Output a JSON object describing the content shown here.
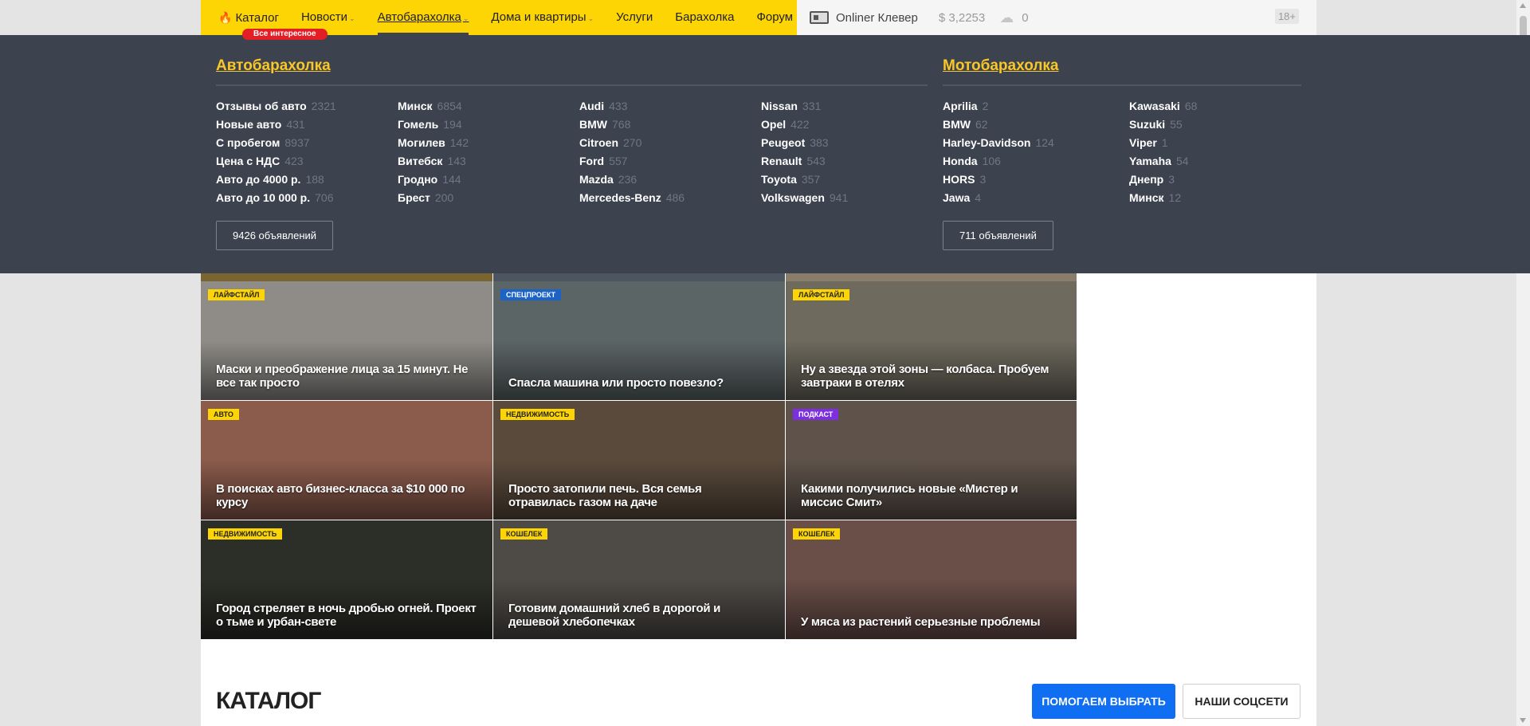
{
  "topbar": {
    "nav": [
      {
        "label": "Каталог",
        "icon": "flame-icon",
        "has_dropdown": false,
        "active": false
      },
      {
        "label": "Новости",
        "has_dropdown": true,
        "active": false
      },
      {
        "label": "Автобарахолка",
        "has_dropdown": true,
        "active": true
      },
      {
        "label": "Дома и квартиры",
        "has_dropdown": true,
        "active": false
      },
      {
        "label": "Услуги",
        "has_dropdown": false,
        "active": false
      },
      {
        "label": "Барахолка",
        "has_dropdown": false,
        "active": false
      },
      {
        "label": "Форум",
        "has_dropdown": false,
        "active": false
      }
    ],
    "promo_badge": "Все интересное",
    "clever": "Onliner Клевер",
    "currency_rate": "$ 3,2253",
    "weather_temp": "0",
    "age_badge": "18+"
  },
  "dropdown": {
    "auto": {
      "title": "Автобарахолка",
      "columns": [
        [
          {
            "name": "Отзывы об авто",
            "count": "2321"
          },
          {
            "name": "Новые авто",
            "count": "431"
          },
          {
            "name": "С пробегом",
            "count": "8937"
          },
          {
            "name": "Цена с НДС",
            "count": "423"
          },
          {
            "name": "Авто до 4000 р.",
            "count": "188"
          },
          {
            "name": "Авто до 10 000 р.",
            "count": "706"
          }
        ],
        [
          {
            "name": "Минск",
            "count": "6854"
          },
          {
            "name": "Гомель",
            "count": "194"
          },
          {
            "name": "Могилев",
            "count": "142"
          },
          {
            "name": "Витебск",
            "count": "143"
          },
          {
            "name": "Гродно",
            "count": "144"
          },
          {
            "name": "Брест",
            "count": "200"
          }
        ],
        [
          {
            "name": "Audi",
            "count": "433"
          },
          {
            "name": "BMW",
            "count": "768"
          },
          {
            "name": "Citroen",
            "count": "270"
          },
          {
            "name": "Ford",
            "count": "557"
          },
          {
            "name": "Mazda",
            "count": "236"
          },
          {
            "name": "Mercedes-Benz",
            "count": "486"
          }
        ],
        [
          {
            "name": "Nissan",
            "count": "331"
          },
          {
            "name": "Opel",
            "count": "422"
          },
          {
            "name": "Peugeot",
            "count": "383"
          },
          {
            "name": "Renault",
            "count": "543"
          },
          {
            "name": "Toyota",
            "count": "357"
          },
          {
            "name": "Volkswagen",
            "count": "941"
          }
        ]
      ],
      "button": "9426 объявлений"
    },
    "moto": {
      "title": "Мотобарахолка",
      "columns": [
        [
          {
            "name": "Aprilia",
            "count": "2"
          },
          {
            "name": "BMW",
            "count": "62"
          },
          {
            "name": "Harley-Davidson",
            "count": "124"
          },
          {
            "name": "Honda",
            "count": "106"
          },
          {
            "name": "HORS",
            "count": "3"
          },
          {
            "name": "Jawa",
            "count": "4"
          }
        ],
        [
          {
            "name": "Kawasaki",
            "count": "68"
          },
          {
            "name": "Suzuki",
            "count": "55"
          },
          {
            "name": "Viper",
            "count": "1"
          },
          {
            "name": "Yamaha",
            "count": "54"
          },
          {
            "name": "Днепр",
            "count": "3"
          },
          {
            "name": "Минск",
            "count": "12"
          }
        ]
      ],
      "button": "711 объявлений"
    }
  },
  "news_tiles": [
    {
      "tag": "Лайфстайл",
      "tag_color": "yellow",
      "title": "Маски и преображение лица за 15 минут. Не все так просто",
      "bg": "#8f8c88"
    },
    {
      "tag": "Спецпроект",
      "tag_color": "blue",
      "title": "Спасла машина или просто повезло?",
      "bg": "#5c6566"
    },
    {
      "tag": "Лайфстайл",
      "tag_color": "yellow",
      "title": "Ну а звезда этой зоны — колбаса. Пробуем завтраки в отелях",
      "bg": "#6e6a5e"
    },
    {
      "tag": "Авто",
      "tag_color": "yellow",
      "title": "В поисках авто бизнес-класса за $10 000 по курсу",
      "bg": "#8b5b4c"
    },
    {
      "tag": "Недвижимость",
      "tag_color": "yellow",
      "title": "Просто затопили печь. Вся семья отравилась газом на даче",
      "bg": "#5a4a3c"
    },
    {
      "tag": "Подкаст",
      "tag_color": "purple",
      "title": "Какими получились новые «Мистер и миссис Смит»",
      "bg": "#5e524a"
    },
    {
      "tag": "Недвижимость",
      "tag_color": "yellow",
      "title": "Город стреляет в ночь дробью огней. Проект о тьме и урбан-свете",
      "bg": "#2c2e28"
    },
    {
      "tag": "Кошелек",
      "tag_color": "yellow",
      "title": "Готовим домашний хлеб в дорогой и дешевой хлебопечках",
      "bg": "#4e4a46"
    },
    {
      "tag": "Кошелек",
      "tag_color": "yellow",
      "title": "У мяса из растений серьезные проблемы",
      "bg": "#6a4e48"
    }
  ],
  "catalog": {
    "title": "КАТАЛОГ",
    "help_button": "ПОМОГАЕМ ВЫБРАТЬ",
    "social_button": "НАШИ СОЦСЕТИ"
  },
  "colors": {
    "accent_yellow": "#fed504",
    "dropdown_bg": "#3c434e",
    "dropdown_title": "#f9c727",
    "primary_blue": "#0f6ef1"
  }
}
